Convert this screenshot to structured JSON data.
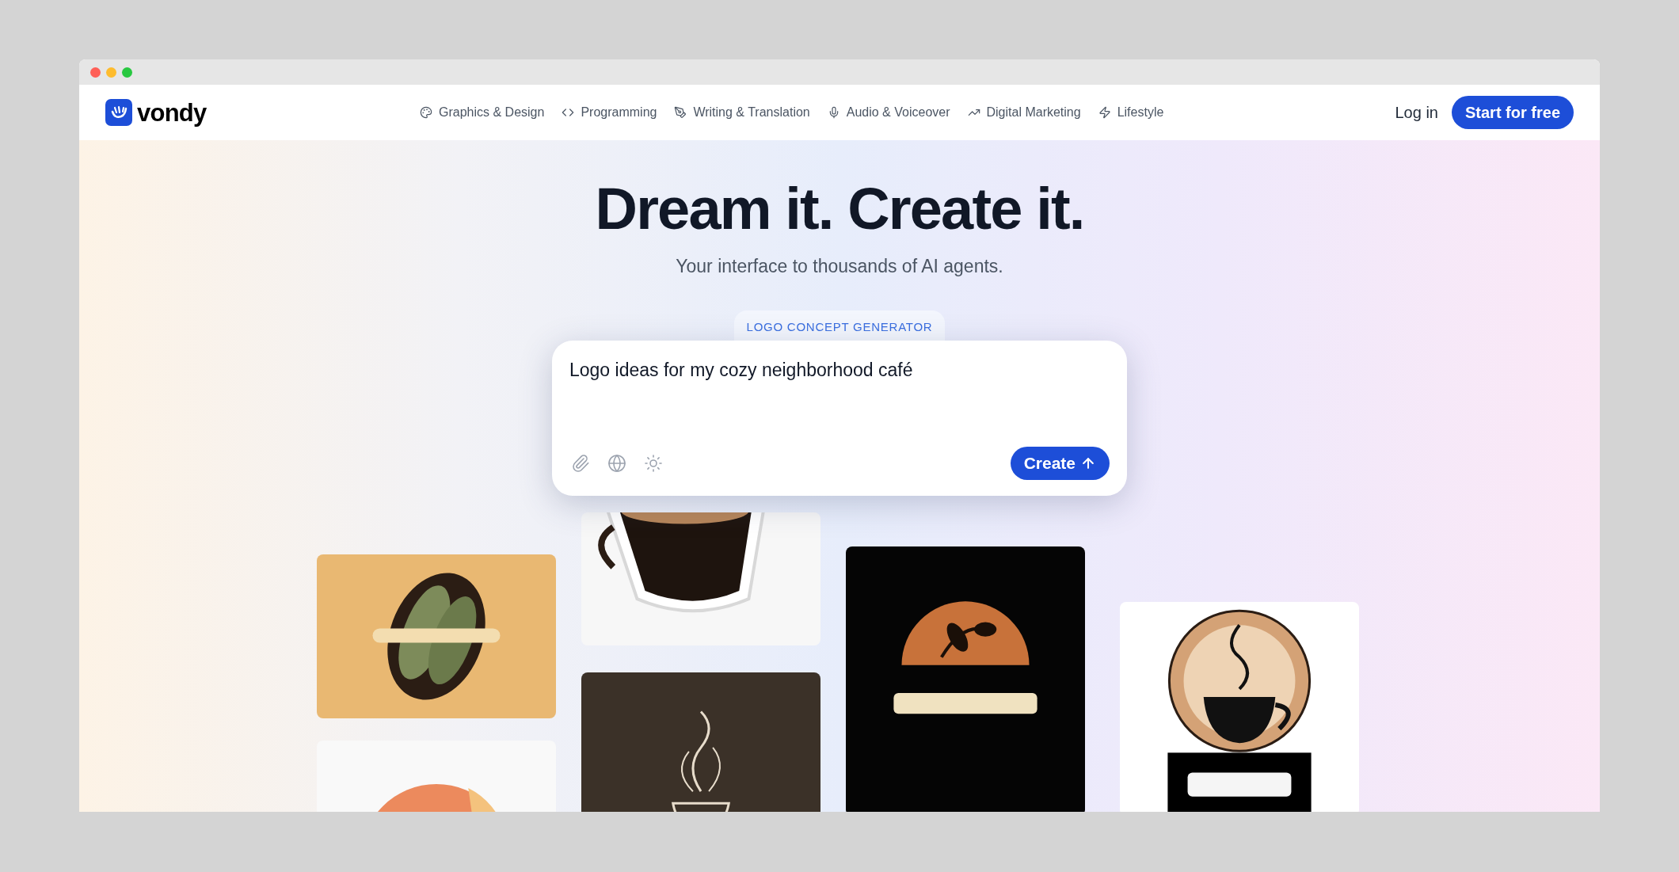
{
  "brand": {
    "name": "vondy"
  },
  "nav": [
    {
      "label": "Graphics & Design"
    },
    {
      "label": "Programming"
    },
    {
      "label": "Writing & Translation"
    },
    {
      "label": "Audio & Voiceover"
    },
    {
      "label": "Digital Marketing"
    },
    {
      "label": "Lifestyle"
    }
  ],
  "auth": {
    "login": "Log in",
    "signup": "Start for free"
  },
  "hero": {
    "title": "Dream it. Create it.",
    "subtitle": "Your interface to thousands of AI agents."
  },
  "prompt": {
    "tag": "LOGO CONCEPT GENERATOR",
    "value": "Logo ideas for my cozy neighborhood café",
    "submit": "Create"
  }
}
